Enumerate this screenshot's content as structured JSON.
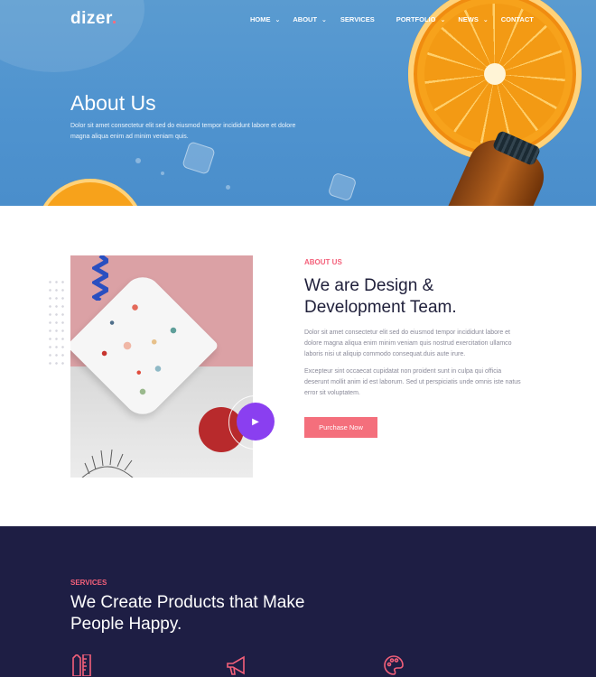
{
  "brand": {
    "logo": "dizer",
    "logo_dot": "."
  },
  "nav": {
    "items": [
      {
        "label": "HOME",
        "dropdown": true
      },
      {
        "label": "ABOUT",
        "dropdown": true
      },
      {
        "label": "SERVICES",
        "dropdown": false
      },
      {
        "label": "PORTFOLIO",
        "dropdown": true
      },
      {
        "label": "NEWS",
        "dropdown": true
      },
      {
        "label": "CONTACT",
        "dropdown": false
      }
    ]
  },
  "hero": {
    "title": "About Us",
    "text": "Dolor sit amet consectetur elit sed do eiusmod tempor incididunt labore et dolore magna aliqua enim ad minim veniam quis."
  },
  "about": {
    "eyebrow": "ABOUT US",
    "heading": "We are Design & Development Team.",
    "paragraph1": "Dolor sit amet consectetur elit sed do eiusmod tempor incididunt labore et dolore magna aliqua enim minim veniam quis nostrud exercitation ullamco laboris nisi ut aliquip commodo consequat.duis aute irure.",
    "paragraph2": "Excepteur sint occaecat cupidatat non proident sunt in culpa qui officia deserunt mollit anim id est laborum. Sed ut perspiciatis unde omnis iste natus error sit voluptatem.",
    "cta": "Purchase Now",
    "play_icon": "play-icon"
  },
  "services": {
    "eyebrow": "SERVICES",
    "heading": "We Create Products that Make People Happy.",
    "icons": [
      "ruler-pencil-icon",
      "megaphone-icon",
      "palette-icon"
    ]
  },
  "colors": {
    "accent": "#f4607a",
    "button": "#f46f7c",
    "play": "#8a3ff0",
    "dark_section": "#1e1e44",
    "heading": "#1f1f3a"
  }
}
